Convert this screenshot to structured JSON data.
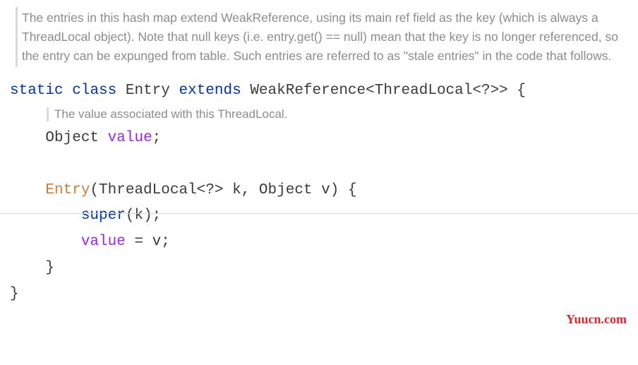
{
  "comments": {
    "top": "The entries in this hash map extend WeakReference, using its main ref field as the key (which is always a ThreadLocal object). Note that null keys (i.e. entry.get() == null) mean that the key is no longer referenced, so the entry can be expunged from table. Such entries are referred to as \"stale entries\" in the code that follows.",
    "inner": "The value associated with this ThreadLocal."
  },
  "code": {
    "kw_static": "static",
    "kw_class": "class",
    "class_name": "Entry",
    "kw_extends": "extends",
    "super_type": "WeakReference<ThreadLocal<?>>",
    "open_brace": "{",
    "field_type": "Object",
    "field_name": "value",
    "semicolon": ";",
    "ctor_name": "Entry",
    "ctor_params_open": "(",
    "ctor_param1_type": "ThreadLocal<?>",
    "ctor_param1_name": "k",
    "comma": ",",
    "ctor_param2_type": "Object",
    "ctor_param2_name": "v",
    "ctor_params_close": ")",
    "body_open": "{",
    "super_call_kw": "super",
    "super_call_arg_open": "(",
    "super_call_arg": "k",
    "super_call_arg_close": ")",
    "stmt_end": ";",
    "assign_left": "value",
    "assign_eq": " = ",
    "assign_right": "v",
    "assign_end": ";",
    "body_close": "}",
    "class_close": "}"
  },
  "watermark": "Yuucn.com"
}
